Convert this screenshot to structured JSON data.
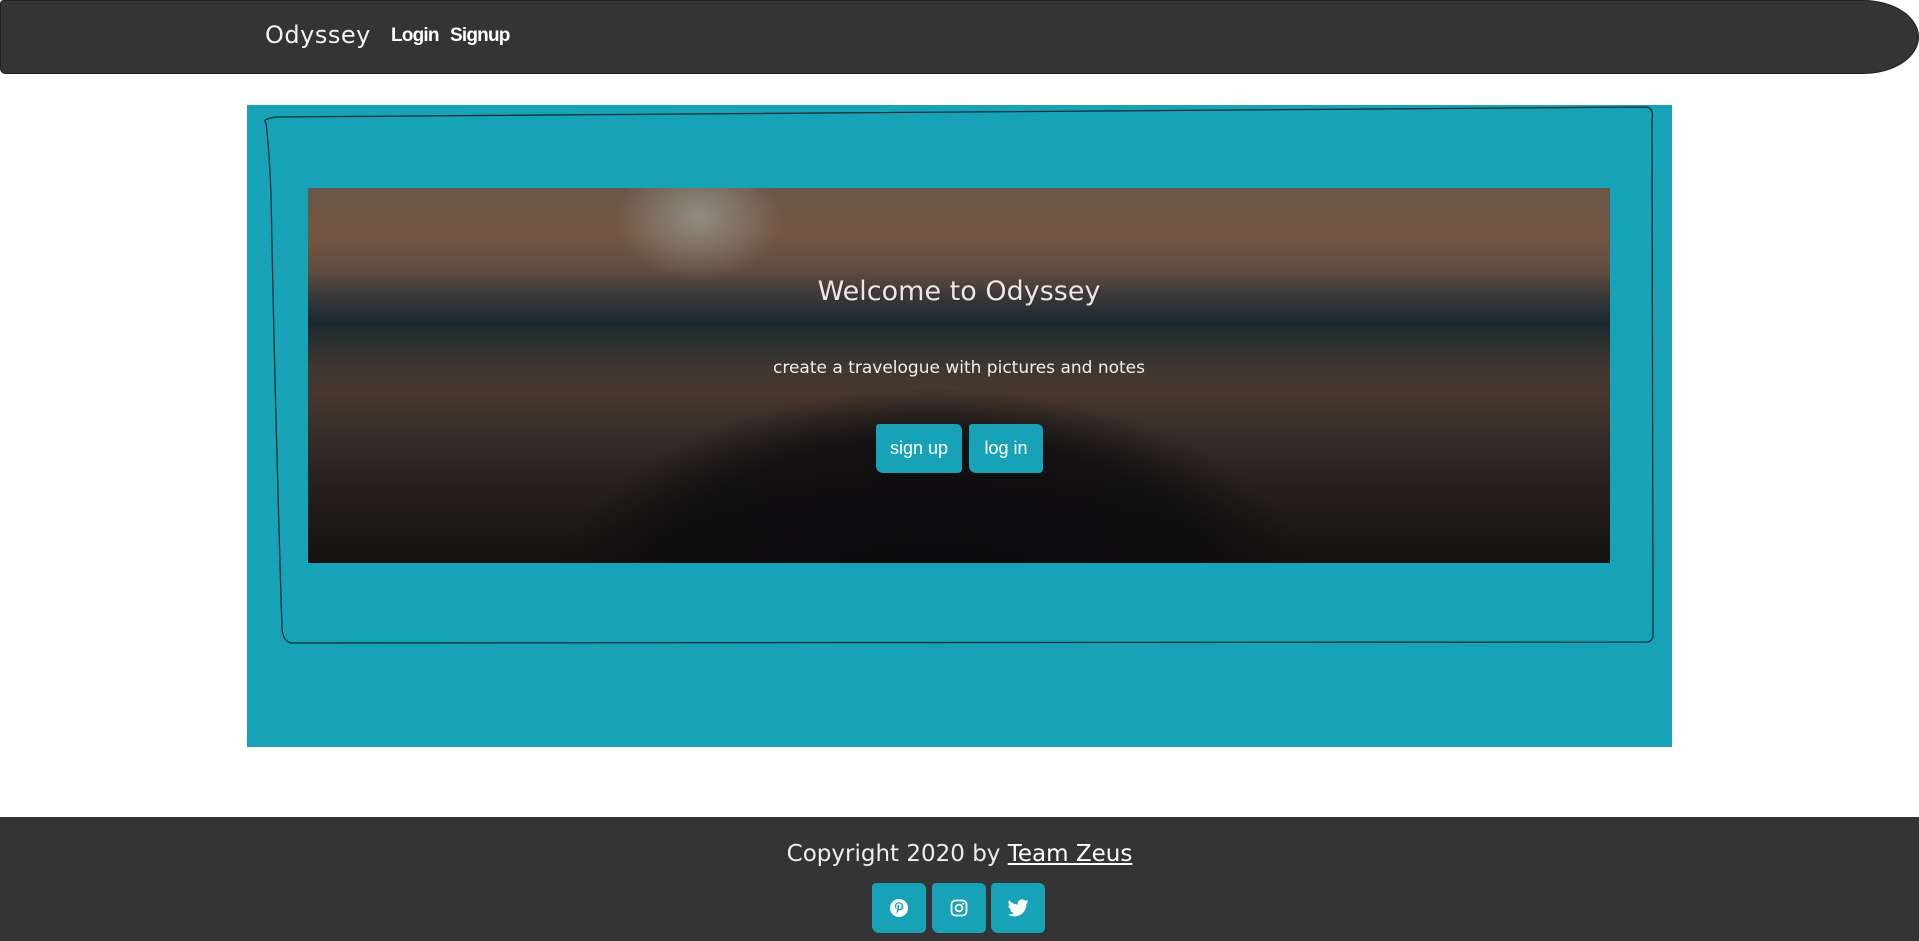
{
  "navbar": {
    "brand": "Odyssey",
    "links": {
      "login": "Login",
      "signup": "Signup"
    }
  },
  "hero": {
    "title": "Welcome to Odyssey",
    "subtitle": "create a travelogue with pictures and notes",
    "buttons": {
      "signup": "sign up",
      "login": "log in"
    }
  },
  "footer": {
    "copyright_prefix": "Copyright 2020 by ",
    "team_link": "Team Zeus",
    "social": [
      "pinterest-icon",
      "instagram-icon",
      "twitter-icon"
    ]
  },
  "colors": {
    "accent": "#17a2b8",
    "dark": "#343434"
  }
}
